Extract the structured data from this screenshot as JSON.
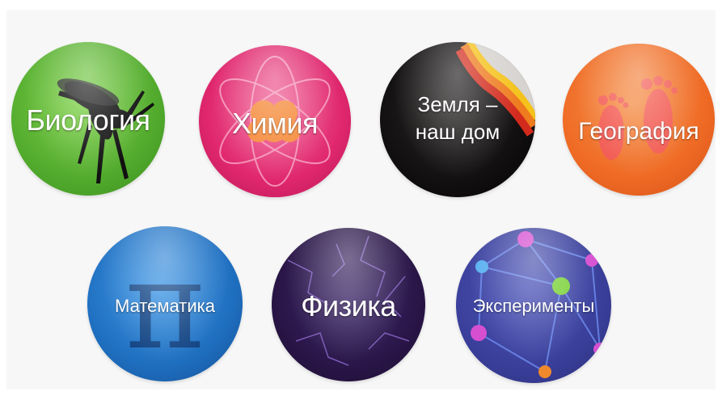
{
  "topics": [
    {
      "label": "Биология",
      "color": "#5cb531"
    },
    {
      "label": "Химия",
      "color": "#e0276e"
    },
    {
      "label": "Земля –\nнаш дом",
      "line1": "Земля –",
      "line2": "наш дом",
      "color": "#0d0b0c"
    },
    {
      "label": "География",
      "color": "#ef6a24"
    },
    {
      "label": "Математика",
      "color": "#1f6fc0"
    },
    {
      "label": "Физика",
      "color": "#2a1648"
    },
    {
      "label": "Эксперименты",
      "color": "#3a3f9a"
    }
  ]
}
